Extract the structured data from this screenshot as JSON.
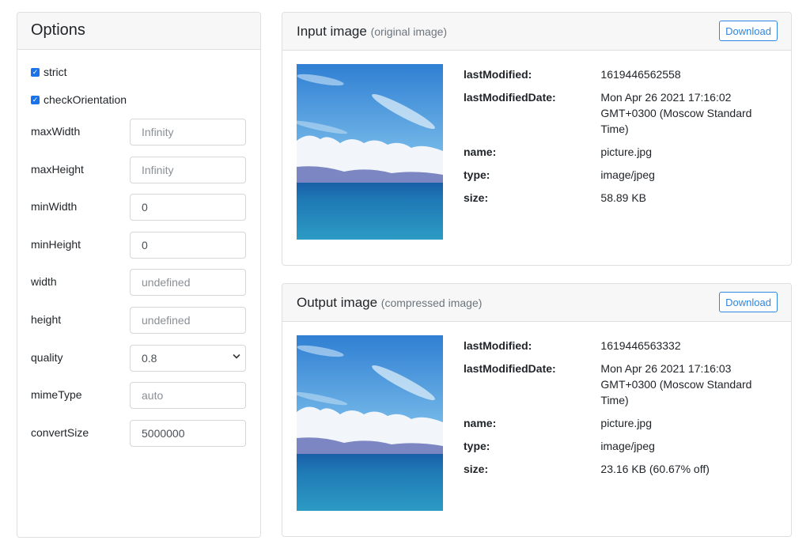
{
  "options": {
    "title": "Options",
    "checkboxes": [
      {
        "label": "strict",
        "checked": true
      },
      {
        "label": "checkOrientation",
        "checked": true
      }
    ],
    "fields": [
      {
        "label": "maxWidth",
        "value": "",
        "placeholder": "Infinity"
      },
      {
        "label": "maxHeight",
        "value": "",
        "placeholder": "Infinity"
      },
      {
        "label": "minWidth",
        "value": "0",
        "placeholder": ""
      },
      {
        "label": "minHeight",
        "value": "0",
        "placeholder": ""
      },
      {
        "label": "width",
        "value": "",
        "placeholder": "undefined"
      },
      {
        "label": "height",
        "value": "",
        "placeholder": "undefined"
      },
      {
        "label": "quality",
        "value": "0.8",
        "type": "select"
      },
      {
        "label": "mimeType",
        "value": "",
        "placeholder": "auto"
      },
      {
        "label": "convertSize",
        "value": "5000000",
        "placeholder": ""
      }
    ]
  },
  "input_image": {
    "title": "Input image",
    "subtitle": "(original image)",
    "download_label": "Download",
    "meta": [
      {
        "key": "lastModified:",
        "value": "1619446562558"
      },
      {
        "key": "lastModifiedDate:",
        "value": "Mon Apr 26 2021 17:16:02 GMT+0300 (Moscow Standard Time)"
      },
      {
        "key": "name:",
        "value": "picture.jpg"
      },
      {
        "key": "type:",
        "value": "image/jpeg"
      },
      {
        "key": "size:",
        "value": "58.89 KB"
      }
    ]
  },
  "output_image": {
    "title": "Output image",
    "subtitle": "(compressed image)",
    "download_label": "Download",
    "meta": [
      {
        "key": "lastModified:",
        "value": "1619446563332"
      },
      {
        "key": "lastModifiedDate:",
        "value": "Mon Apr 26 2021 17:16:03 GMT+0300 (Moscow Standard Time)"
      },
      {
        "key": "name:",
        "value": "picture.jpg"
      },
      {
        "key": "type:",
        "value": "image/jpeg"
      },
      {
        "key": "size:",
        "value": "23.16 KB (60.67% off)"
      }
    ]
  },
  "colors": {
    "accent": "#2e86de",
    "checkbox": "#1a73e8",
    "header_bg": "#f7f7f7"
  }
}
